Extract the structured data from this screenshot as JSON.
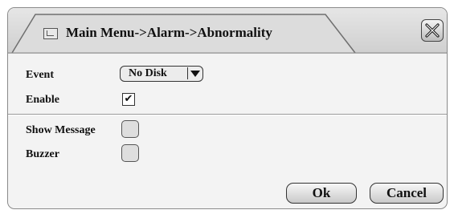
{
  "window": {
    "title": "Main Menu->Alarm->Abnormality",
    "tab_icon": "window-icon",
    "close_icon": "close-x-icon"
  },
  "form": {
    "event_label": "Event",
    "event_value": "No Disk",
    "enable_label": "Enable",
    "enable_checked": true,
    "enable_check_glyph": "✔",
    "show_message_label": "Show Message",
    "show_message_checked": false,
    "buzzer_label": "Buzzer",
    "buzzer_checked": false
  },
  "buttons": {
    "ok_label": "Ok",
    "cancel_label": "Cancel"
  }
}
